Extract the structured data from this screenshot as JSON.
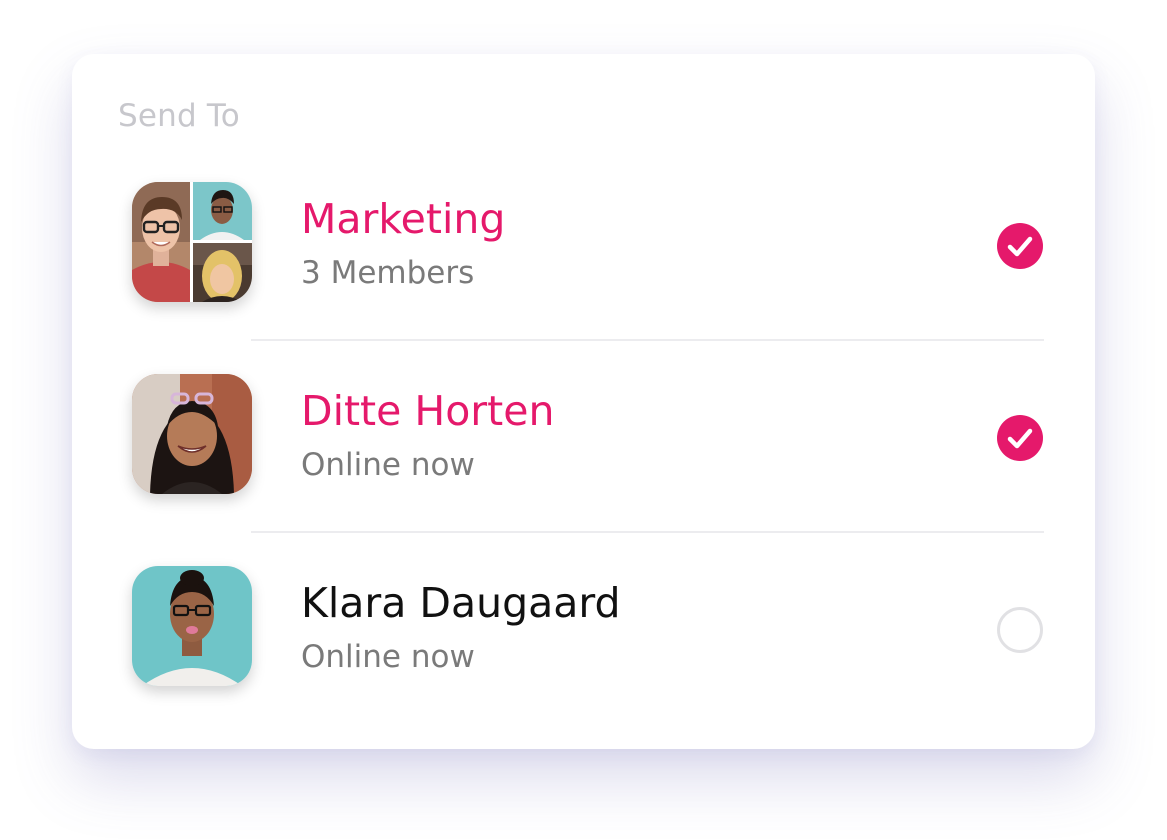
{
  "panel": {
    "title": "Send To"
  },
  "recipients": [
    {
      "name": "Marketing",
      "subtitle": "3 Members",
      "selected": true,
      "avatar": "group-photo-collage"
    },
    {
      "name": "Ditte Horten",
      "subtitle": "Online now",
      "selected": true,
      "avatar": "person-photo"
    },
    {
      "name": "Klara Daugaard",
      "subtitle": "Online now",
      "selected": false,
      "avatar": "person-photo"
    }
  ],
  "colors": {
    "accent": "#e5196b",
    "title": "#c7c7cc",
    "subtitle": "#7a7a7a",
    "divider": "#ececef",
    "unchecked_border": "#e1e1e4"
  },
  "icons": {
    "selected": "checkmark-icon",
    "unselected": "empty-circle-icon"
  }
}
